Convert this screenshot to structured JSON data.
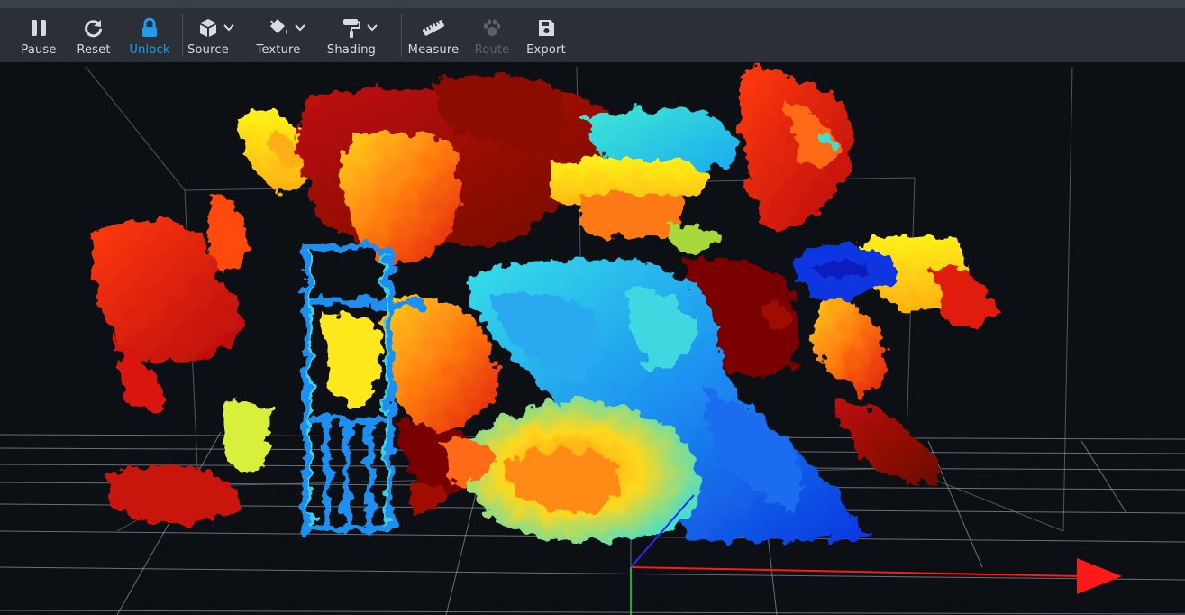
{
  "toolbar": {
    "pause": "Pause",
    "reset": "Reset",
    "unlock": "Unlock",
    "source": "Source",
    "texture": "Texture",
    "shading": "Shading",
    "measure": "Measure",
    "route": "Route",
    "export": "Export"
  },
  "colors": {
    "toolbar_bg": "#2b3037",
    "accent_active": "#1e9cf0",
    "disabled": "#5b626b",
    "viewport_bg": "#0c1015",
    "x_axis": "#ff1a1a",
    "y_axis": "#1a1aff",
    "z_axis": "#22dd55"
  },
  "icons": {
    "pause": "pause-icon",
    "reset": "refresh-icon",
    "unlock": "lock-icon",
    "source": "cube-icon",
    "texture": "paint-bucket-icon",
    "shading": "paint-roller-icon",
    "measure": "ruler-icon",
    "route": "paw-icon",
    "export": "save-icon"
  }
}
